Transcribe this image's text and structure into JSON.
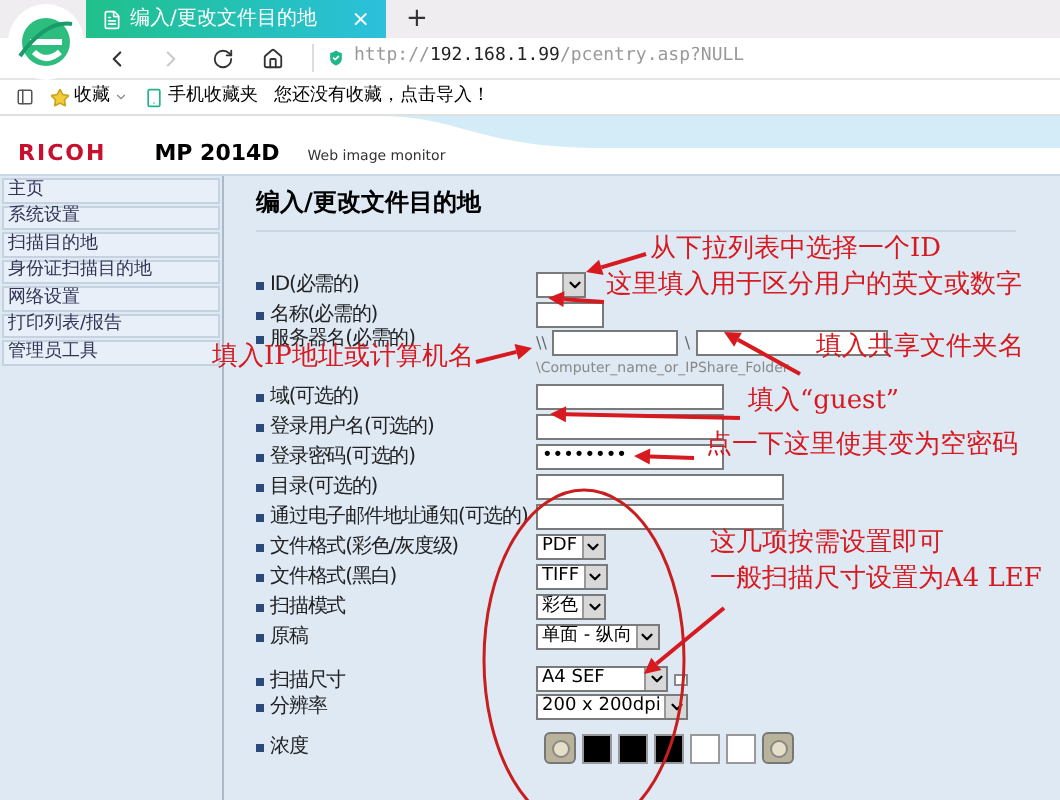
{
  "browser": {
    "tab_title": "编入/更改文件目的地",
    "tab_close": "×",
    "new_tab": "+",
    "url_scheme": "http://",
    "url_host": "192.168.1.99",
    "url_path": "/pcentry.asp?NULL",
    "bookmarks": [
      {
        "kind": "menu",
        "label": "收藏"
      },
      {
        "kind": "phone",
        "label": "手机收藏夹"
      },
      {
        "kind": "plain",
        "label": "您还没有收藏，点击导入！"
      }
    ]
  },
  "header": {
    "brand": "RICOH",
    "model": "MP 2014D",
    "product": "Web image monitor"
  },
  "sidebar": {
    "items": [
      "主页",
      "系统设置",
      "扫描目的地",
      "身份证扫描目的地",
      "网络设置",
      "打印列表/报告",
      "管理员工具"
    ]
  },
  "form": {
    "title": "编入/更改文件目的地",
    "rows": [
      {
        "kind": "select",
        "label": "ID(必需的)"
      },
      {
        "kind": "text",
        "label": "名称(必需的)"
      },
      {
        "kind": "server",
        "label": "服务器名(必需的)",
        "prefix": "\\\\",
        "separator": "\\",
        "hint": "\\Computer_name_or_IPShare_Folder"
      },
      {
        "kind": "text",
        "label": "域(可选的)"
      },
      {
        "kind": "text",
        "label": "登录用户名(可选的)"
      },
      {
        "kind": "password",
        "label": "登录密码(可选的)",
        "value": "••••••••"
      },
      {
        "kind": "text",
        "label": "目录(可选的)"
      },
      {
        "kind": "text",
        "label": "通过电子邮件地址通知(可选的)"
      },
      {
        "kind": "select",
        "label": "文件格式(彩色/灰度级)",
        "value": "PDF"
      },
      {
        "kind": "select",
        "label": "文件格式(黑白)",
        "value": "TIFF"
      },
      {
        "kind": "select",
        "label": "扫描模式",
        "value": "彩色"
      },
      {
        "kind": "select",
        "label": "原稿",
        "value": "单面 - 纵向"
      },
      {
        "kind": "select_note",
        "label": "扫描尺寸",
        "value": "A4 SEF"
      },
      {
        "kind": "select",
        "label": "分辨率",
        "value": "200 x 200dpi"
      },
      {
        "kind": "swatches",
        "label": "浓度",
        "swatches": [
          {
            "color": "#000000"
          },
          {
            "color": "#000000"
          },
          {
            "color": "#000000"
          },
          {
            "color": "#ffffff"
          },
          {
            "color": "#ffffff"
          }
        ]
      }
    ]
  },
  "annotations": [
    "从下拉列表中选择一个ID",
    "这里填入用于区分用户的英文或数字",
    "填入IP地址或计算机名",
    "填入共享文件夹名",
    "填入“guest”",
    "点一下这里使其变为空密码",
    "这几项按需设置即可",
    "一般扫描尺寸设置为A4 LEF"
  ]
}
